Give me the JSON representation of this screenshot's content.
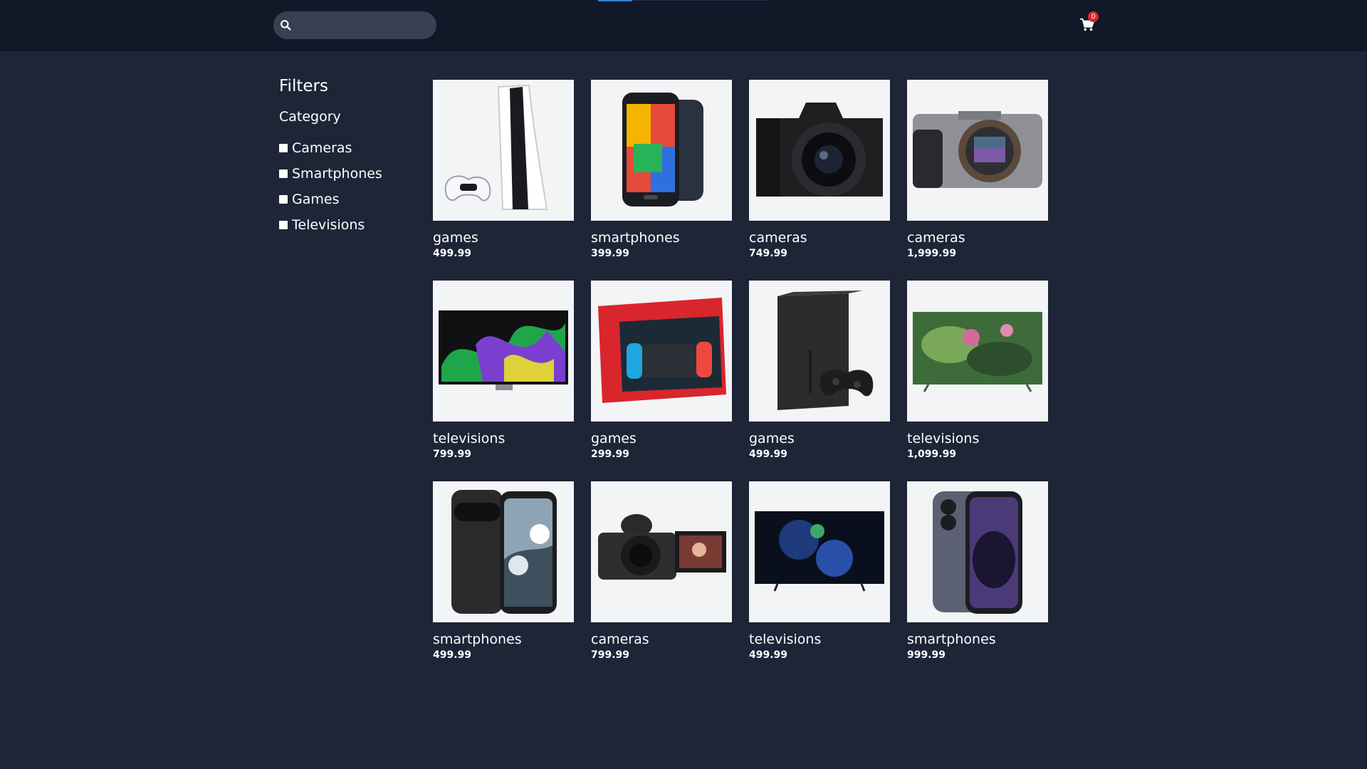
{
  "header": {
    "search": {
      "value": "",
      "placeholder": ""
    },
    "cart_count": "0"
  },
  "sidebar": {
    "title": "Filters",
    "category_title": "Category",
    "categories": [
      {
        "label": "Cameras",
        "checked": false
      },
      {
        "label": "Smartphones",
        "checked": false
      },
      {
        "label": "Games",
        "checked": false
      },
      {
        "label": "Televisions",
        "checked": false
      }
    ]
  },
  "products": [
    {
      "category": "games",
      "price": "499.99",
      "image": "console-white-icon"
    },
    {
      "category": "smartphones",
      "price": "399.99",
      "image": "smartphone-icon"
    },
    {
      "category": "cameras",
      "price": "749.99",
      "image": "dslr-camera-icon"
    },
    {
      "category": "cameras",
      "price": "1,999.99",
      "image": "mirrorless-camera-icon"
    },
    {
      "category": "televisions",
      "price": "799.99",
      "image": "oled-tv-icon"
    },
    {
      "category": "games",
      "price": "299.99",
      "image": "handheld-console-icon"
    },
    {
      "category": "games",
      "price": "499.99",
      "image": "console-black-icon"
    },
    {
      "category": "televisions",
      "price": "1,099.99",
      "image": "uhd-tv-icon"
    },
    {
      "category": "smartphones",
      "price": "499.99",
      "image": "smartphone-icon"
    },
    {
      "category": "cameras",
      "price": "799.99",
      "image": "vlog-camera-icon"
    },
    {
      "category": "televisions",
      "price": "499.99",
      "image": "fire-tv-icon"
    },
    {
      "category": "smartphones",
      "price": "999.99",
      "image": "smartphone-icon"
    }
  ],
  "colors": {
    "header_bg": "#111827",
    "page_bg": "#1d2537",
    "card_bg": "#f3f4f6",
    "badge": "#dc2626"
  }
}
